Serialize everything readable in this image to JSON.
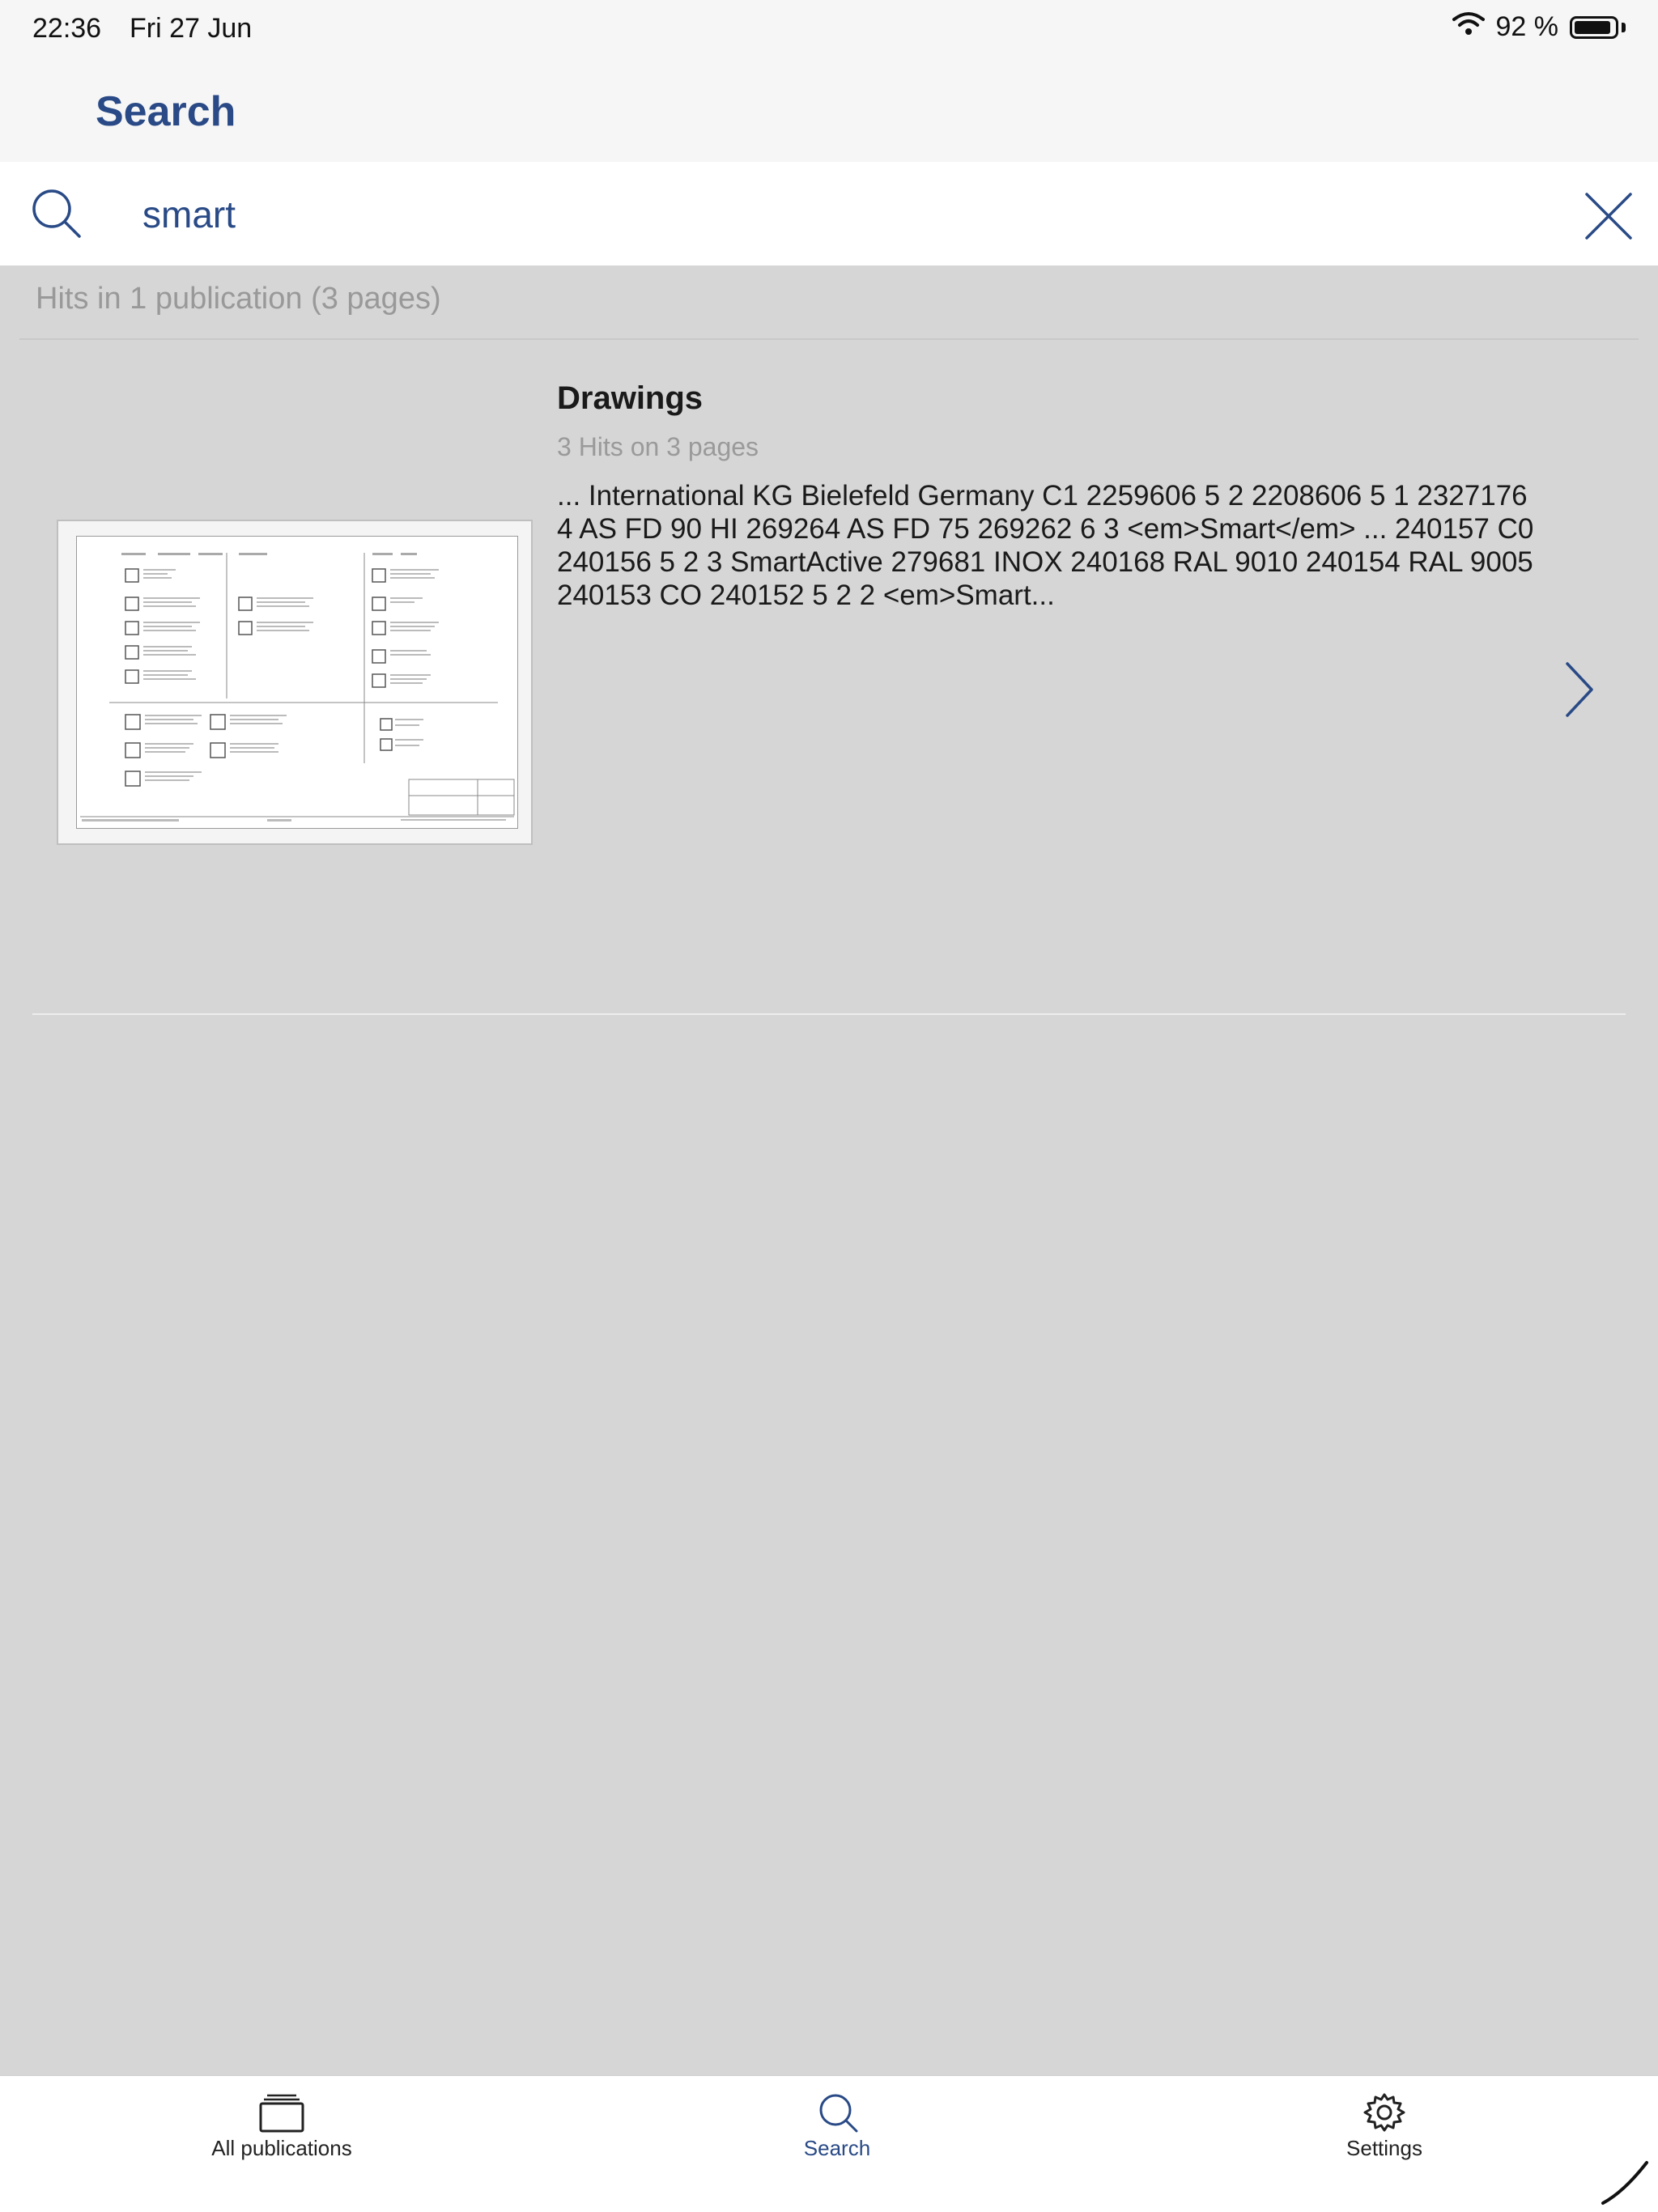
{
  "status_bar": {
    "time": "22:36",
    "date": "Fri 27 Jun",
    "battery_text": "92 %",
    "battery_level": 0.92,
    "wifi_icon": "wifi-icon",
    "battery_icon": "battery-icon"
  },
  "nav": {
    "title": "Search"
  },
  "search": {
    "value": "smart",
    "search_icon": "search-icon",
    "clear_icon": "close-icon"
  },
  "results": {
    "summary": "Hits in 1 publication (3 pages)",
    "items": [
      {
        "title": "Drawings",
        "subtitle": "3 Hits on 3 pages",
        "snippet": "... International KG Bielefeld Germany C1 2259606 5 2 2208606 5 1 2327176 4 AS FD 90 HI 269264 AS FD 75 269262 6 3 <em>Smart</em> ... 240157 C0 240156 5 2 3 SmartActive 279681 INOX 240168 RAL 9010 240154 RAL 9005 240153 CO 240152 5 2 2 <em>Smart...",
        "chevron_icon": "chevron-right-icon"
      }
    ]
  },
  "tab_bar": {
    "tabs": [
      {
        "label": "All publications",
        "icon": "publications-icon",
        "active": false
      },
      {
        "label": "Search",
        "icon": "search-icon",
        "active": true
      },
      {
        "label": "Settings",
        "icon": "gear-icon",
        "active": false
      }
    ]
  },
  "colors": {
    "accent": "#294a86",
    "background": "#d6d6d6",
    "bar_background": "#f6f6f6",
    "secondary_text": "#999999"
  }
}
